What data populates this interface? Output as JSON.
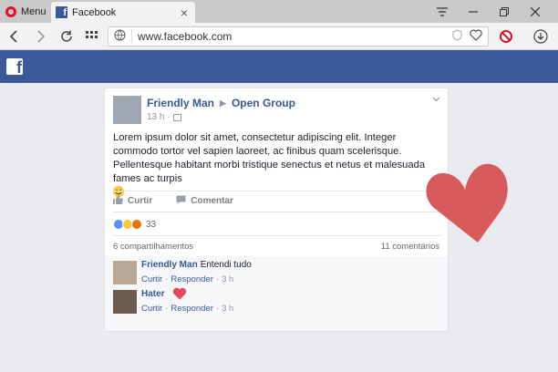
{
  "browser": {
    "menu_label": "Menu",
    "tab_title": "Facebook",
    "url": "www.facebook.com"
  },
  "post": {
    "author": "Friendly Man",
    "group": "Open Group",
    "time": "13 h",
    "text": "Lorem ipsum dolor sit amet, consectetur adipiscing elit. Integer commodo tortor vel sapien laoreet, ac finibus quam scelerisque. Pellentesque habitant morbi tristique senectus et netus et malesuada fames ac turpis",
    "like_label": "Curtir",
    "comment_label": "Comentar",
    "reactions_count": "33",
    "shares_label": "6 compartilhamentos",
    "comments_label": "11 comentários"
  },
  "comments": [
    {
      "author": "Friendly Man",
      "text": "Entendi tudo",
      "like": "Curtir",
      "reply": "Responder",
      "time": "3 h"
    },
    {
      "author": "Hater",
      "text": "",
      "like": "Curtir",
      "reply": "Responder",
      "time": "3 h"
    }
  ],
  "colors": {
    "fb_blue": "#3b5998",
    "link_blue": "#365899",
    "heart_red": "#d9534f"
  }
}
